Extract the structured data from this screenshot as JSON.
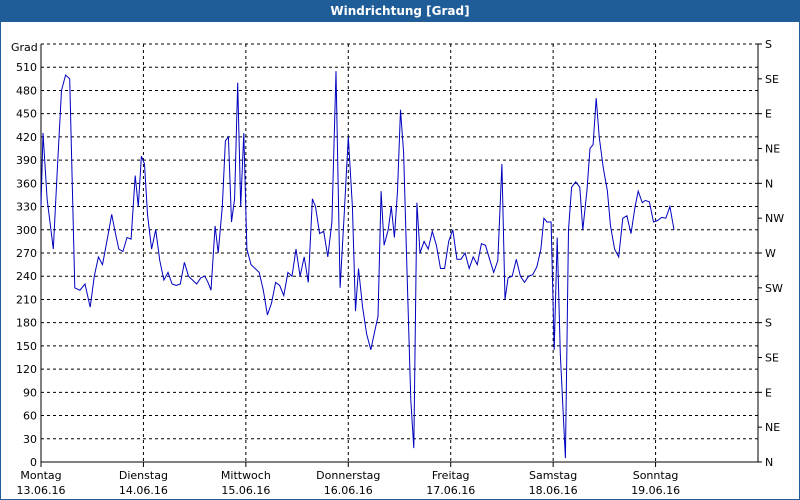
{
  "window": {
    "title": "Windrichtung [Grad]"
  },
  "chart_data": {
    "type": "line",
    "title": "Windrichtung [Grad]",
    "ylabel": "Grad",
    "ylim": [
      0,
      540
    ],
    "yticks": [
      0,
      30,
      60,
      90,
      120,
      150,
      180,
      210,
      240,
      270,
      300,
      330,
      360,
      390,
      420,
      450,
      480,
      510
    ],
    "right_ticks": [
      {
        "value": 0,
        "label": "N"
      },
      {
        "value": 45,
        "label": "NE"
      },
      {
        "value": 90,
        "label": "E"
      },
      {
        "value": 135,
        "label": "SE"
      },
      {
        "value": 180,
        "label": "S"
      },
      {
        "value": 225,
        "label": "SW"
      },
      {
        "value": 270,
        "label": "W"
      },
      {
        "value": 315,
        "label": "NW"
      },
      {
        "value": 360,
        "label": "N"
      },
      {
        "value": 405,
        "label": "NE"
      },
      {
        "value": 450,
        "label": "E"
      },
      {
        "value": 495,
        "label": "SE"
      },
      {
        "value": 540,
        "label": "S"
      }
    ],
    "xlim": [
      0,
      7
    ],
    "x_days": [
      {
        "day": "Montag",
        "date": "13.06.16"
      },
      {
        "day": "Dienstag",
        "date": "14.06.16"
      },
      {
        "day": "Mittwoch",
        "date": "15.06.16"
      },
      {
        "day": "Donnerstag",
        "date": "16.06.16"
      },
      {
        "day": "Freitag",
        "date": "17.06.16"
      },
      {
        "day": "Samstag",
        "date": "18.06.16"
      },
      {
        "day": "Sonntag",
        "date": "19.06.16"
      }
    ],
    "grid": true,
    "series": [
      {
        "color": "#0000c0",
        "points": [
          [
            0,
            330
          ],
          [
            0.02,
            425
          ],
          [
            0.06,
            340
          ],
          [
            0.12,
            275
          ],
          [
            0.16,
            380
          ],
          [
            0.2,
            480
          ],
          [
            0.24,
            500
          ],
          [
            0.28,
            495
          ],
          [
            0.33,
            225
          ],
          [
            0.38,
            222
          ],
          [
            0.43,
            230
          ],
          [
            0.48,
            200
          ],
          [
            0.52,
            240
          ],
          [
            0.56,
            265
          ],
          [
            0.6,
            255
          ],
          [
            0.65,
            290
          ],
          [
            0.69,
            320
          ],
          [
            0.72,
            300
          ],
          [
            0.76,
            275
          ],
          [
            0.8,
            272
          ],
          [
            0.84,
            290
          ],
          [
            0.88,
            288
          ],
          [
            0.92,
            370
          ],
          [
            0.95,
            330
          ],
          [
            0.98,
            395
          ],
          [
            1.01,
            385
          ],
          [
            1.04,
            320
          ],
          [
            1.08,
            275
          ],
          [
            1.12,
            300
          ],
          [
            1.16,
            260
          ],
          [
            1.2,
            235
          ],
          [
            1.24,
            245
          ],
          [
            1.28,
            230
          ],
          [
            1.32,
            228
          ],
          [
            1.36,
            230
          ],
          [
            1.4,
            258
          ],
          [
            1.44,
            240
          ],
          [
            1.48,
            235
          ],
          [
            1.52,
            230
          ],
          [
            1.56,
            238
          ],
          [
            1.6,
            240
          ],
          [
            1.63,
            232
          ],
          [
            1.66,
            222
          ],
          [
            1.7,
            305
          ],
          [
            1.73,
            270
          ],
          [
            1.77,
            330
          ],
          [
            1.8,
            415
          ],
          [
            1.83,
            420
          ],
          [
            1.86,
            310
          ],
          [
            1.89,
            340
          ],
          [
            1.92,
            490
          ],
          [
            1.95,
            330
          ],
          [
            1.98,
            425
          ],
          [
            2.01,
            275
          ],
          [
            2.05,
            255
          ],
          [
            2.09,
            250
          ],
          [
            2.13,
            245
          ],
          [
            2.17,
            222
          ],
          [
            2.21,
            190
          ],
          [
            2.25,
            205
          ],
          [
            2.29,
            232
          ],
          [
            2.33,
            228
          ],
          [
            2.37,
            215
          ],
          [
            2.41,
            245
          ],
          [
            2.45,
            240
          ],
          [
            2.49,
            275
          ],
          [
            2.53,
            240
          ],
          [
            2.57,
            265
          ],
          [
            2.61,
            232
          ],
          [
            2.65,
            340
          ],
          [
            2.68,
            330
          ],
          [
            2.72,
            295
          ],
          [
            2.76,
            298
          ],
          [
            2.8,
            265
          ],
          [
            2.84,
            310
          ],
          [
            2.88,
            505
          ],
          [
            2.92,
            225
          ],
          [
            2.96,
            320
          ],
          [
            3.0,
            420
          ],
          [
            3.04,
            330
          ],
          [
            3.07,
            195
          ],
          [
            3.1,
            250
          ],
          [
            3.14,
            200
          ],
          [
            3.18,
            165
          ],
          [
            3.22,
            145
          ],
          [
            3.26,
            170
          ],
          [
            3.29,
            188
          ],
          [
            3.32,
            350
          ],
          [
            3.35,
            280
          ],
          [
            3.39,
            300
          ],
          [
            3.42,
            330
          ],
          [
            3.45,
            290
          ],
          [
            3.48,
            350
          ],
          [
            3.51,
            455
          ],
          [
            3.54,
            400
          ],
          [
            3.57,
            260
          ],
          [
            3.61,
            80
          ],
          [
            3.64,
            18
          ],
          [
            3.67,
            335
          ],
          [
            3.7,
            270
          ],
          [
            3.74,
            285
          ],
          [
            3.78,
            275
          ],
          [
            3.82,
            298
          ],
          [
            3.86,
            280
          ],
          [
            3.9,
            250
          ],
          [
            3.94,
            250
          ],
          [
            3.98,
            285
          ],
          [
            4.02,
            300
          ],
          [
            4.06,
            262
          ],
          [
            4.1,
            262
          ],
          [
            4.14,
            270
          ],
          [
            4.18,
            250
          ],
          [
            4.22,
            265
          ],
          [
            4.26,
            255
          ],
          [
            4.3,
            282
          ],
          [
            4.34,
            280
          ],
          [
            4.38,
            262
          ],
          [
            4.42,
            245
          ],
          [
            4.46,
            260
          ],
          [
            4.5,
            385
          ],
          [
            4.53,
            210
          ],
          [
            4.56,
            238
          ],
          [
            4.6,
            240
          ],
          [
            4.64,
            262
          ],
          [
            4.68,
            240
          ],
          [
            4.72,
            232
          ],
          [
            4.76,
            240
          ],
          [
            4.8,
            242
          ],
          [
            4.84,
            252
          ],
          [
            4.88,
            275
          ],
          [
            4.91,
            315
          ],
          [
            4.94,
            310
          ],
          [
            4.98,
            310
          ],
          [
            5.01,
            145
          ],
          [
            5.04,
            290
          ],
          [
            5.07,
            140
          ],
          [
            5.12,
            5
          ],
          [
            5.15,
            300
          ],
          [
            5.18,
            355
          ],
          [
            5.22,
            362
          ],
          [
            5.26,
            355
          ],
          [
            5.29,
            300
          ],
          [
            5.33,
            350
          ],
          [
            5.36,
            405
          ],
          [
            5.39,
            410
          ],
          [
            5.42,
            470
          ],
          [
            5.45,
            420
          ],
          [
            5.49,
            380
          ],
          [
            5.53,
            350
          ],
          [
            5.56,
            305
          ],
          [
            5.6,
            275
          ],
          [
            5.64,
            265
          ],
          [
            5.68,
            315
          ],
          [
            5.72,
            318
          ],
          [
            5.76,
            295
          ],
          [
            5.8,
            330
          ],
          [
            5.83,
            350
          ],
          [
            5.87,
            335
          ],
          [
            5.9,
            338
          ],
          [
            5.94,
            336
          ],
          [
            5.98,
            310
          ],
          [
            6.02,
            312
          ],
          [
            6.06,
            316
          ],
          [
            6.1,
            315
          ],
          [
            6.14,
            330
          ],
          [
            6.18,
            300
          ]
        ]
      }
    ]
  }
}
